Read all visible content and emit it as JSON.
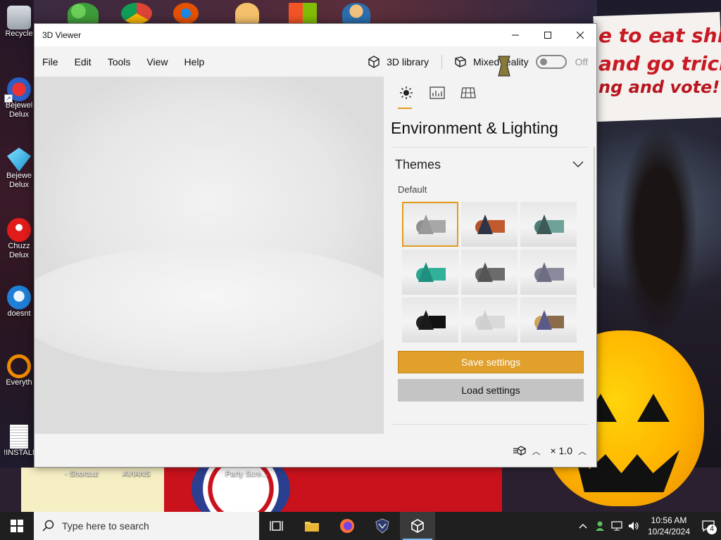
{
  "desktop": {
    "icons": [
      {
        "label": "Recycle",
        "icon": "recycle-bin-icon"
      },
      {
        "label": "Bejewel\nDelux",
        "icon": "bejeweled-icon"
      },
      {
        "label": "Bejewe\nDelux",
        "icon": "bejeweled-diamond-icon"
      },
      {
        "label": "Chuzz\nDelux",
        "icon": "chuzzle-icon"
      },
      {
        "label": "doesnt",
        "icon": "doesnt-icon"
      },
      {
        "label": "Everyth",
        "icon": "everything-search-icon"
      },
      {
        "label": "!INSTALI",
        "icon": "install-document-icon"
      }
    ],
    "bottom_labels": [
      "- Shortcut",
      "AVIANS",
      "Party Scre..."
    ],
    "poster_text": [
      "e to eat shit",
      "and go trick",
      "ng and vote!"
    ]
  },
  "window": {
    "title": "3D Viewer",
    "menu": [
      "File",
      "Edit",
      "Tools",
      "View",
      "Help"
    ],
    "library_label": "3D library",
    "mixed_reality_label": "Mixed reality",
    "toggle_state": "Off",
    "panel": {
      "heading": "Environment & Lighting",
      "tabs": [
        "lighting-tab",
        "stats-tab",
        "grid-tab"
      ],
      "section_title": "Themes",
      "theme_label": "Default",
      "themes": [
        {
          "cone": "#9a9a9a",
          "ball": "#8f8f8f",
          "box": "#a7a7a7"
        },
        {
          "cone": "#2d3447",
          "ball": "#b5532b",
          "box": "#c05a2e"
        },
        {
          "cone": "#3e5a56",
          "ball": "#4a7f76",
          "box": "#6ea298"
        },
        {
          "cone": "#1f8f7f",
          "ball": "#2aa590",
          "box": "#31b09a"
        },
        {
          "cone": "#555",
          "ball": "#666",
          "box": "#6b6b6b"
        },
        {
          "cone": "#6e6e82",
          "ball": "#7b7b90",
          "box": "#8a8a9c"
        },
        {
          "cone": "#1a1a1a",
          "ball": "#222",
          "box": "#111"
        },
        {
          "cone": "#cfcfcf",
          "ball": "#d4d4d4",
          "box": "#dadada"
        },
        {
          "cone": "#5a5a8a",
          "ball": "#c9a45a",
          "box": "#8a6b4a"
        }
      ],
      "selected_theme_index": 0,
      "save_label": "Save settings",
      "load_label": "Load settings"
    },
    "status": {
      "zoom_label": "× 1.0"
    }
  },
  "taskbar": {
    "search_placeholder": "Type here to search",
    "time": "10:56 AM",
    "date": "10/24/2024",
    "notification_count": "4",
    "accent": "#76b9ed"
  },
  "colors": {
    "accent": "#e0a02b",
    "load_button": "#c4c4c4"
  }
}
